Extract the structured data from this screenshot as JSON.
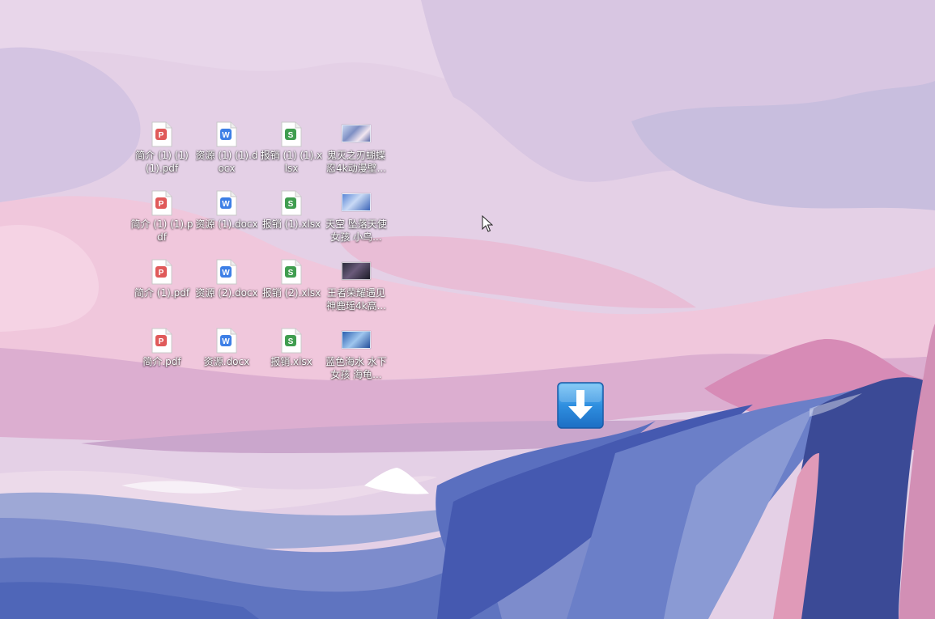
{
  "desktop": {
    "icons": [
      {
        "name": "desktop-icon-pdf-jianjie-111",
        "label": "简介 (1) (1) (1).pdf",
        "type": "pdf"
      },
      {
        "name": "desktop-icon-docx-ziyuan-11",
        "label": "资源 (1) (1).docx",
        "type": "docx"
      },
      {
        "name": "desktop-icon-xlsx-baoxiao-11",
        "label": "报销 (1) (1).xlsx",
        "type": "xlsx"
      },
      {
        "name": "desktop-icon-image-guimie",
        "label": "鬼灭之刃蝴蝶忍4k动漫壁...",
        "type": "image"
      },
      {
        "name": "desktop-icon-pdf-jianjie-11",
        "label": "简介 (1) (1).pdf",
        "type": "pdf"
      },
      {
        "name": "desktop-icon-docx-ziyuan-1",
        "label": "资源 (1).docx",
        "type": "docx"
      },
      {
        "name": "desktop-icon-xlsx-baoxiao-1",
        "label": "报销 (1).xlsx",
        "type": "xlsx"
      },
      {
        "name": "desktop-icon-image-tiankong",
        "label": "天空 坠落天使 女孩 小鸟...",
        "type": "image"
      },
      {
        "name": "desktop-icon-pdf-jianjie-1",
        "label": "简介 (1).pdf",
        "type": "pdf"
      },
      {
        "name": "desktop-icon-docx-ziyuan-2",
        "label": "资源 (2).docx",
        "type": "docx"
      },
      {
        "name": "desktop-icon-xlsx-baoxiao-2",
        "label": "报销 (2).xlsx",
        "type": "xlsx"
      },
      {
        "name": "desktop-icon-image-wangzhe",
        "label": "王者荣耀遇见神鹿瑶4k高...",
        "type": "image"
      },
      {
        "name": "desktop-icon-pdf-jianjie",
        "label": "简介.pdf",
        "type": "pdf"
      },
      {
        "name": "desktop-icon-docx-ziyuan",
        "label": "资源.docx",
        "type": "docx"
      },
      {
        "name": "desktop-icon-xlsx-baoxiao",
        "label": "报销.xlsx",
        "type": "xlsx"
      },
      {
        "name": "desktop-icon-image-lanse",
        "label": "蓝色海水 水下女孩 海龟...",
        "type": "image"
      }
    ],
    "download_app": {
      "icon": "download-arrow-icon"
    },
    "cursor": {
      "icon": "mouse-pointer-icon"
    }
  },
  "colors": {
    "pdf": "#e05a5a",
    "docx": "#3d7fe6",
    "xlsx": "#3f9d4f",
    "download": "#2f8fe0"
  }
}
